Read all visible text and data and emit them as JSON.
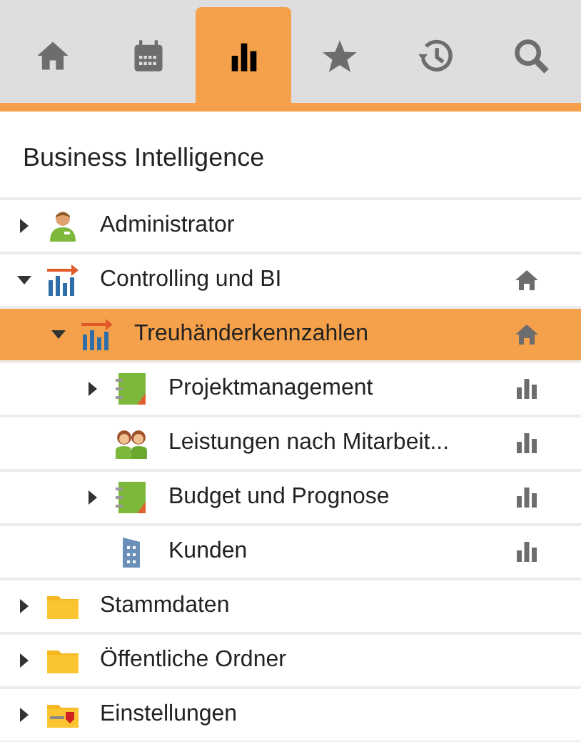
{
  "tabs": [
    {
      "kind": "home",
      "selected": false
    },
    {
      "kind": "calendar",
      "selected": false
    },
    {
      "kind": "chart",
      "selected": true
    },
    {
      "kind": "star",
      "selected": false
    },
    {
      "kind": "history",
      "selected": false
    },
    {
      "kind": "search",
      "selected": false
    }
  ],
  "heading": "Business Intelligence",
  "tree": [
    {
      "label": "Administrator",
      "kind": "user",
      "expandable": true,
      "expanded": false,
      "selected": false,
      "home_mark": false,
      "chart_mark": false
    },
    {
      "label": "Controlling und BI",
      "kind": "report",
      "expandable": true,
      "expanded": true,
      "selected": false,
      "home_mark": true,
      "chart_mark": false,
      "children": [
        {
          "label": "Treuhänderkennzahlen",
          "kind": "report",
          "expandable": true,
          "expanded": true,
          "selected": true,
          "home_mark": true,
          "chart_mark": false,
          "children": [
            {
              "label": "Projektmanagement",
              "kind": "book",
              "expandable": true,
              "expanded": false,
              "selected": false,
              "home_mark": false,
              "chart_mark": true
            },
            {
              "label": "Leistungen nach Mitarbeit...",
              "kind": "people",
              "expandable": false,
              "selected": false,
              "home_mark": false,
              "chart_mark": true
            },
            {
              "label": "Budget und Prognose",
              "kind": "book",
              "expandable": true,
              "expanded": false,
              "selected": false,
              "home_mark": false,
              "chart_mark": true
            },
            {
              "label": "Kunden",
              "kind": "building",
              "expandable": false,
              "selected": false,
              "home_mark": false,
              "chart_mark": true
            }
          ]
        }
      ]
    },
    {
      "label": "Stammdaten",
      "kind": "folder",
      "expandable": true,
      "expanded": false,
      "selected": false,
      "home_mark": false,
      "chart_mark": false
    },
    {
      "label": "Öffentliche Ordner",
      "kind": "folder",
      "expandable": true,
      "expanded": false,
      "selected": false,
      "home_mark": false,
      "chart_mark": false
    },
    {
      "label": "Einstellungen",
      "kind": "settings-folder",
      "expandable": true,
      "expanded": false,
      "selected": false,
      "home_mark": false,
      "chart_mark": false
    }
  ]
}
